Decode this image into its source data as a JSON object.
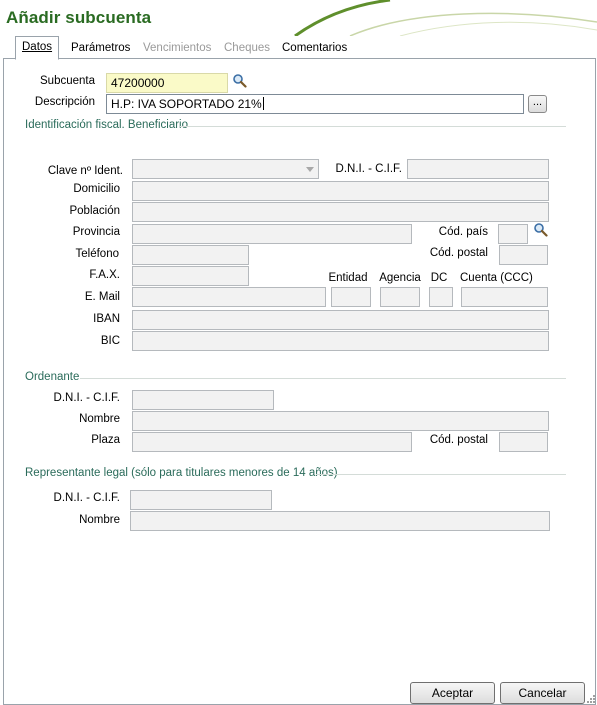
{
  "window": {
    "title": "Añadir subcuenta"
  },
  "tabs": [
    {
      "label": "Datos",
      "state": "active"
    },
    {
      "label": "Parámetros",
      "state": "enabled"
    },
    {
      "label": "Vencimientos",
      "state": "disabled"
    },
    {
      "label": "Cheques",
      "state": "disabled"
    },
    {
      "label": "Comentarios",
      "state": "enabled"
    }
  ],
  "account": {
    "subcuenta_label": "Subcuenta",
    "subcuenta_value": "47200000",
    "descripcion_label": "Descripción",
    "descripcion_value": "H.P: IVA SOPORTADO 21%",
    "ellipsis_label": "..."
  },
  "fiscal": {
    "section_title": "Identificación fiscal. Beneficiario",
    "clave_label": "Clave nº Ident.",
    "dni_label": "D.N.I. - C.I.F.",
    "domicilio_label": "Domicilio",
    "poblacion_label": "Población",
    "provincia_label": "Provincia",
    "cod_pais_label": "Cód. país",
    "telefono_label": "Teléfono",
    "cod_postal_label": "Cód. postal",
    "fax_label": "F.A.X.",
    "entidad_label": "Entidad",
    "agencia_label": "Agencia",
    "dc_label": "DC",
    "cuenta_label": "Cuenta (CCC)",
    "email_label": "E. Mail",
    "iban_label": "IBAN",
    "bic_label": "BIC"
  },
  "ordenante": {
    "section_title": "Ordenante",
    "dni_label": "D.N.I. - C.I.F.",
    "nombre_label": "Nombre",
    "plaza_label": "Plaza",
    "cod_postal_label": "Cód. postal"
  },
  "representante": {
    "section_title": "Representante legal (sólo para titulares menores de 14 años)",
    "dni_label": "D.N.I. - C.I.F.",
    "nombre_label": "Nombre"
  },
  "buttons": {
    "accept": "Aceptar",
    "cancel": "Cancelar"
  },
  "icons": {
    "search": "magnifier-icon",
    "dropdown": "chevron-down-icon"
  },
  "colors": {
    "title": "#2a6b22",
    "section": "#2a6b5a",
    "subcuenta_bg": "#fafac8"
  }
}
